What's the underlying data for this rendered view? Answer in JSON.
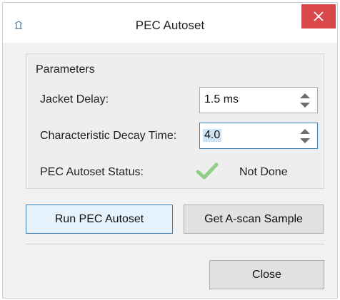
{
  "window": {
    "title": "PEC Autoset",
    "app_icon": "app-icon",
    "close_icon": "close-icon"
  },
  "group": {
    "label": "Parameters"
  },
  "fields": {
    "jacket_delay": {
      "label": "Jacket Delay:",
      "value": "1.5 ms"
    },
    "decay_time": {
      "label": "Characteristic Decay Time:",
      "value": "4.0"
    },
    "status": {
      "label": "PEC Autoset Status:",
      "value": "Not Done",
      "icon": "checkmark-icon"
    }
  },
  "buttons": {
    "run": "Run PEC Autoset",
    "get_sample": "Get A-scan Sample",
    "close": "Close"
  },
  "colors": {
    "close_red": "#d9474a",
    "check_green": "#8fcf86",
    "selection": "#cfe3f7",
    "primary_border": "#3c7fb1"
  }
}
